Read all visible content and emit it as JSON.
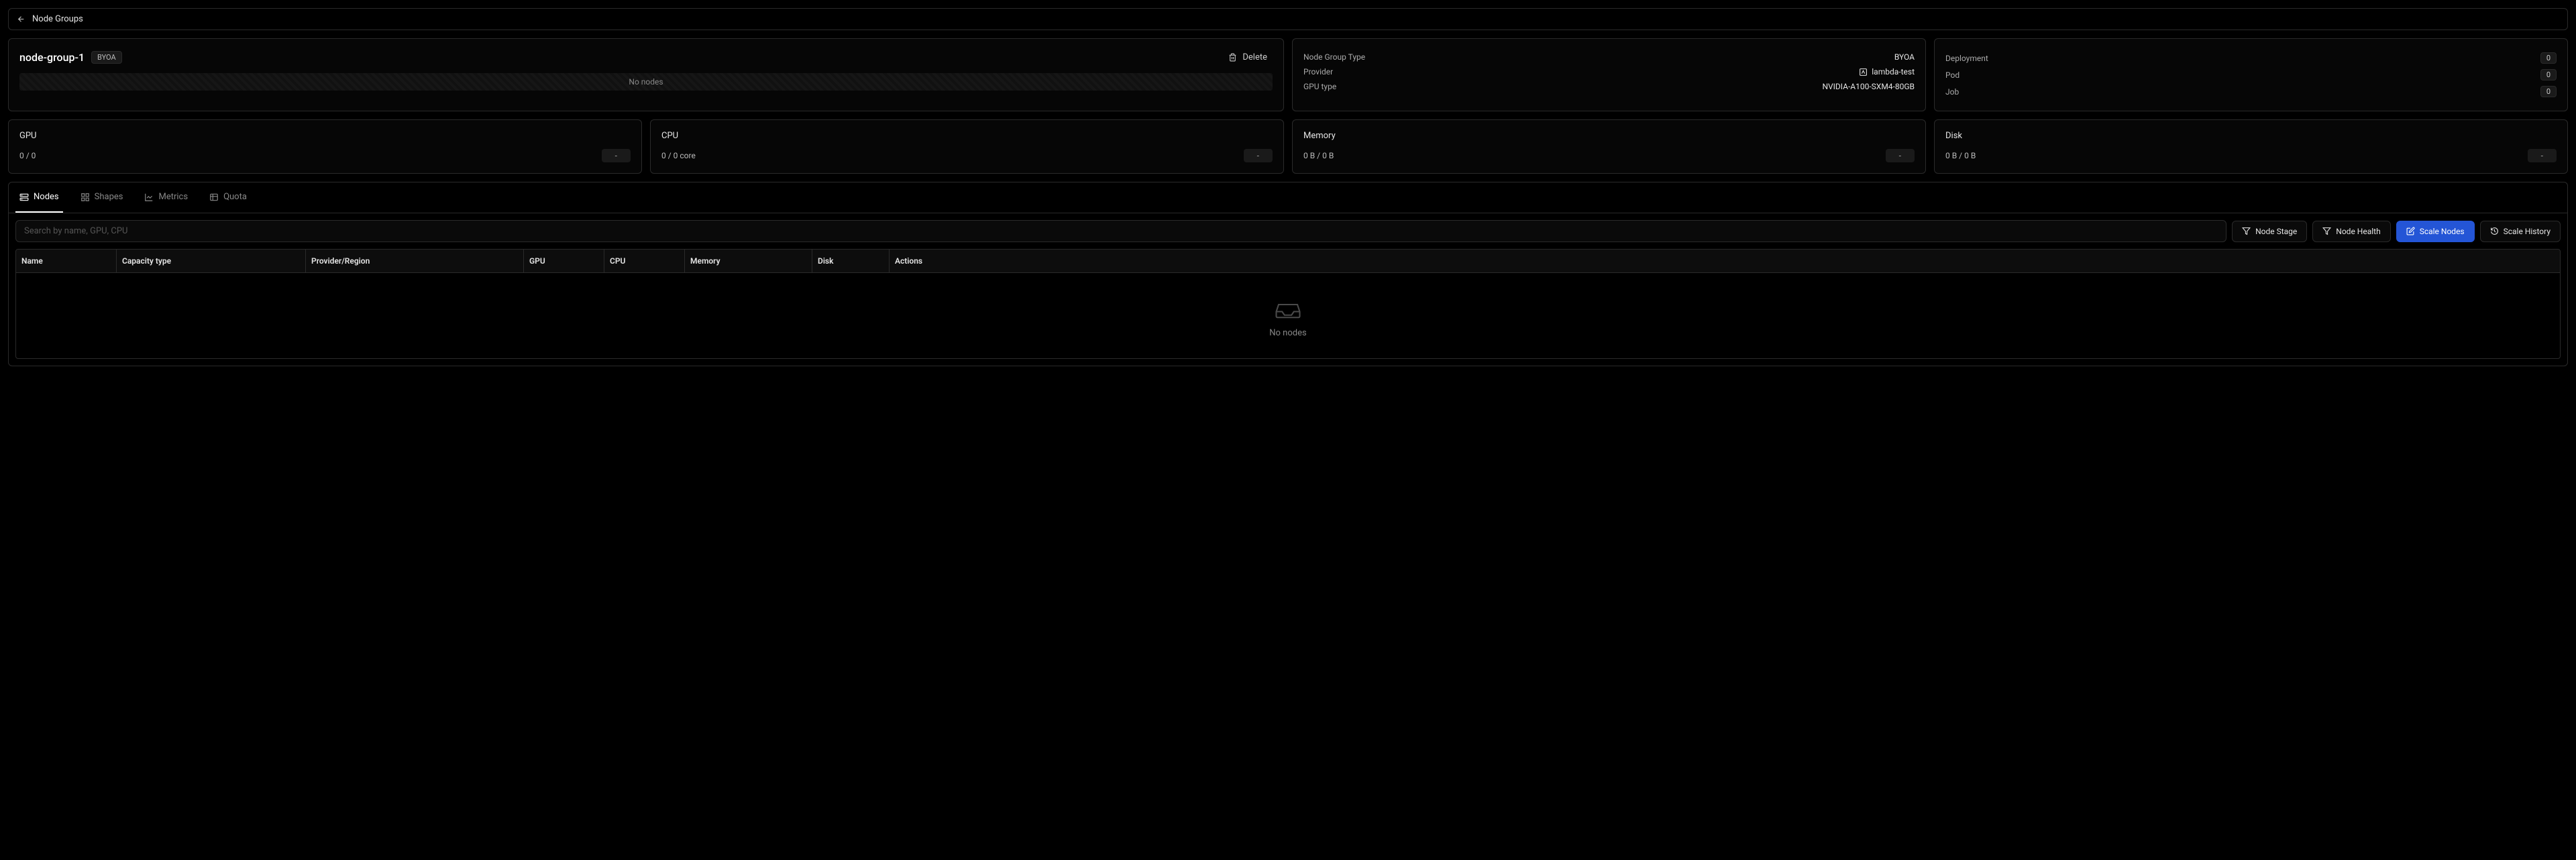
{
  "breadcrumb": {
    "label": "Node Groups"
  },
  "header": {
    "title": "node-group-1",
    "badge": "BYOA",
    "delete_label": "Delete",
    "no_nodes_label": "No nodes"
  },
  "info": {
    "node_group_type": {
      "key": "Node Group Type",
      "val": "BYOA"
    },
    "provider": {
      "key": "Provider",
      "val": "lambda-test"
    },
    "gpu_type": {
      "key": "GPU type",
      "val": "NVIDIA-A100-SXM4-80GB"
    }
  },
  "counts": {
    "deployment": {
      "key": "Deployment",
      "val": "0"
    },
    "pod": {
      "key": "Pod",
      "val": "0"
    },
    "job": {
      "key": "Job",
      "val": "0"
    }
  },
  "stats": {
    "gpu": {
      "title": "GPU",
      "value": "0 / 0",
      "pill": "-"
    },
    "cpu": {
      "title": "CPU",
      "value": "0 / 0 core",
      "pill": "-"
    },
    "memory": {
      "title": "Memory",
      "value": "0 B / 0 B",
      "pill": "-"
    },
    "disk": {
      "title": "Disk",
      "value": "0 B / 0 B",
      "pill": "-"
    }
  },
  "tabs": {
    "nodes": "Nodes",
    "shapes": "Shapes",
    "metrics": "Metrics",
    "quota": "Quota"
  },
  "toolbar": {
    "search_placeholder": "Search by name, GPU, CPU",
    "node_stage": "Node Stage",
    "node_health": "Node Health",
    "scale_nodes": "Scale Nodes",
    "scale_history": "Scale History"
  },
  "table": {
    "columns": {
      "name": "Name",
      "capacity_type": "Capacity type",
      "provider_region": "Provider/Region",
      "gpu": "GPU",
      "cpu": "CPU",
      "memory": "Memory",
      "disk": "Disk",
      "actions": "Actions"
    },
    "empty_label": "No nodes"
  }
}
